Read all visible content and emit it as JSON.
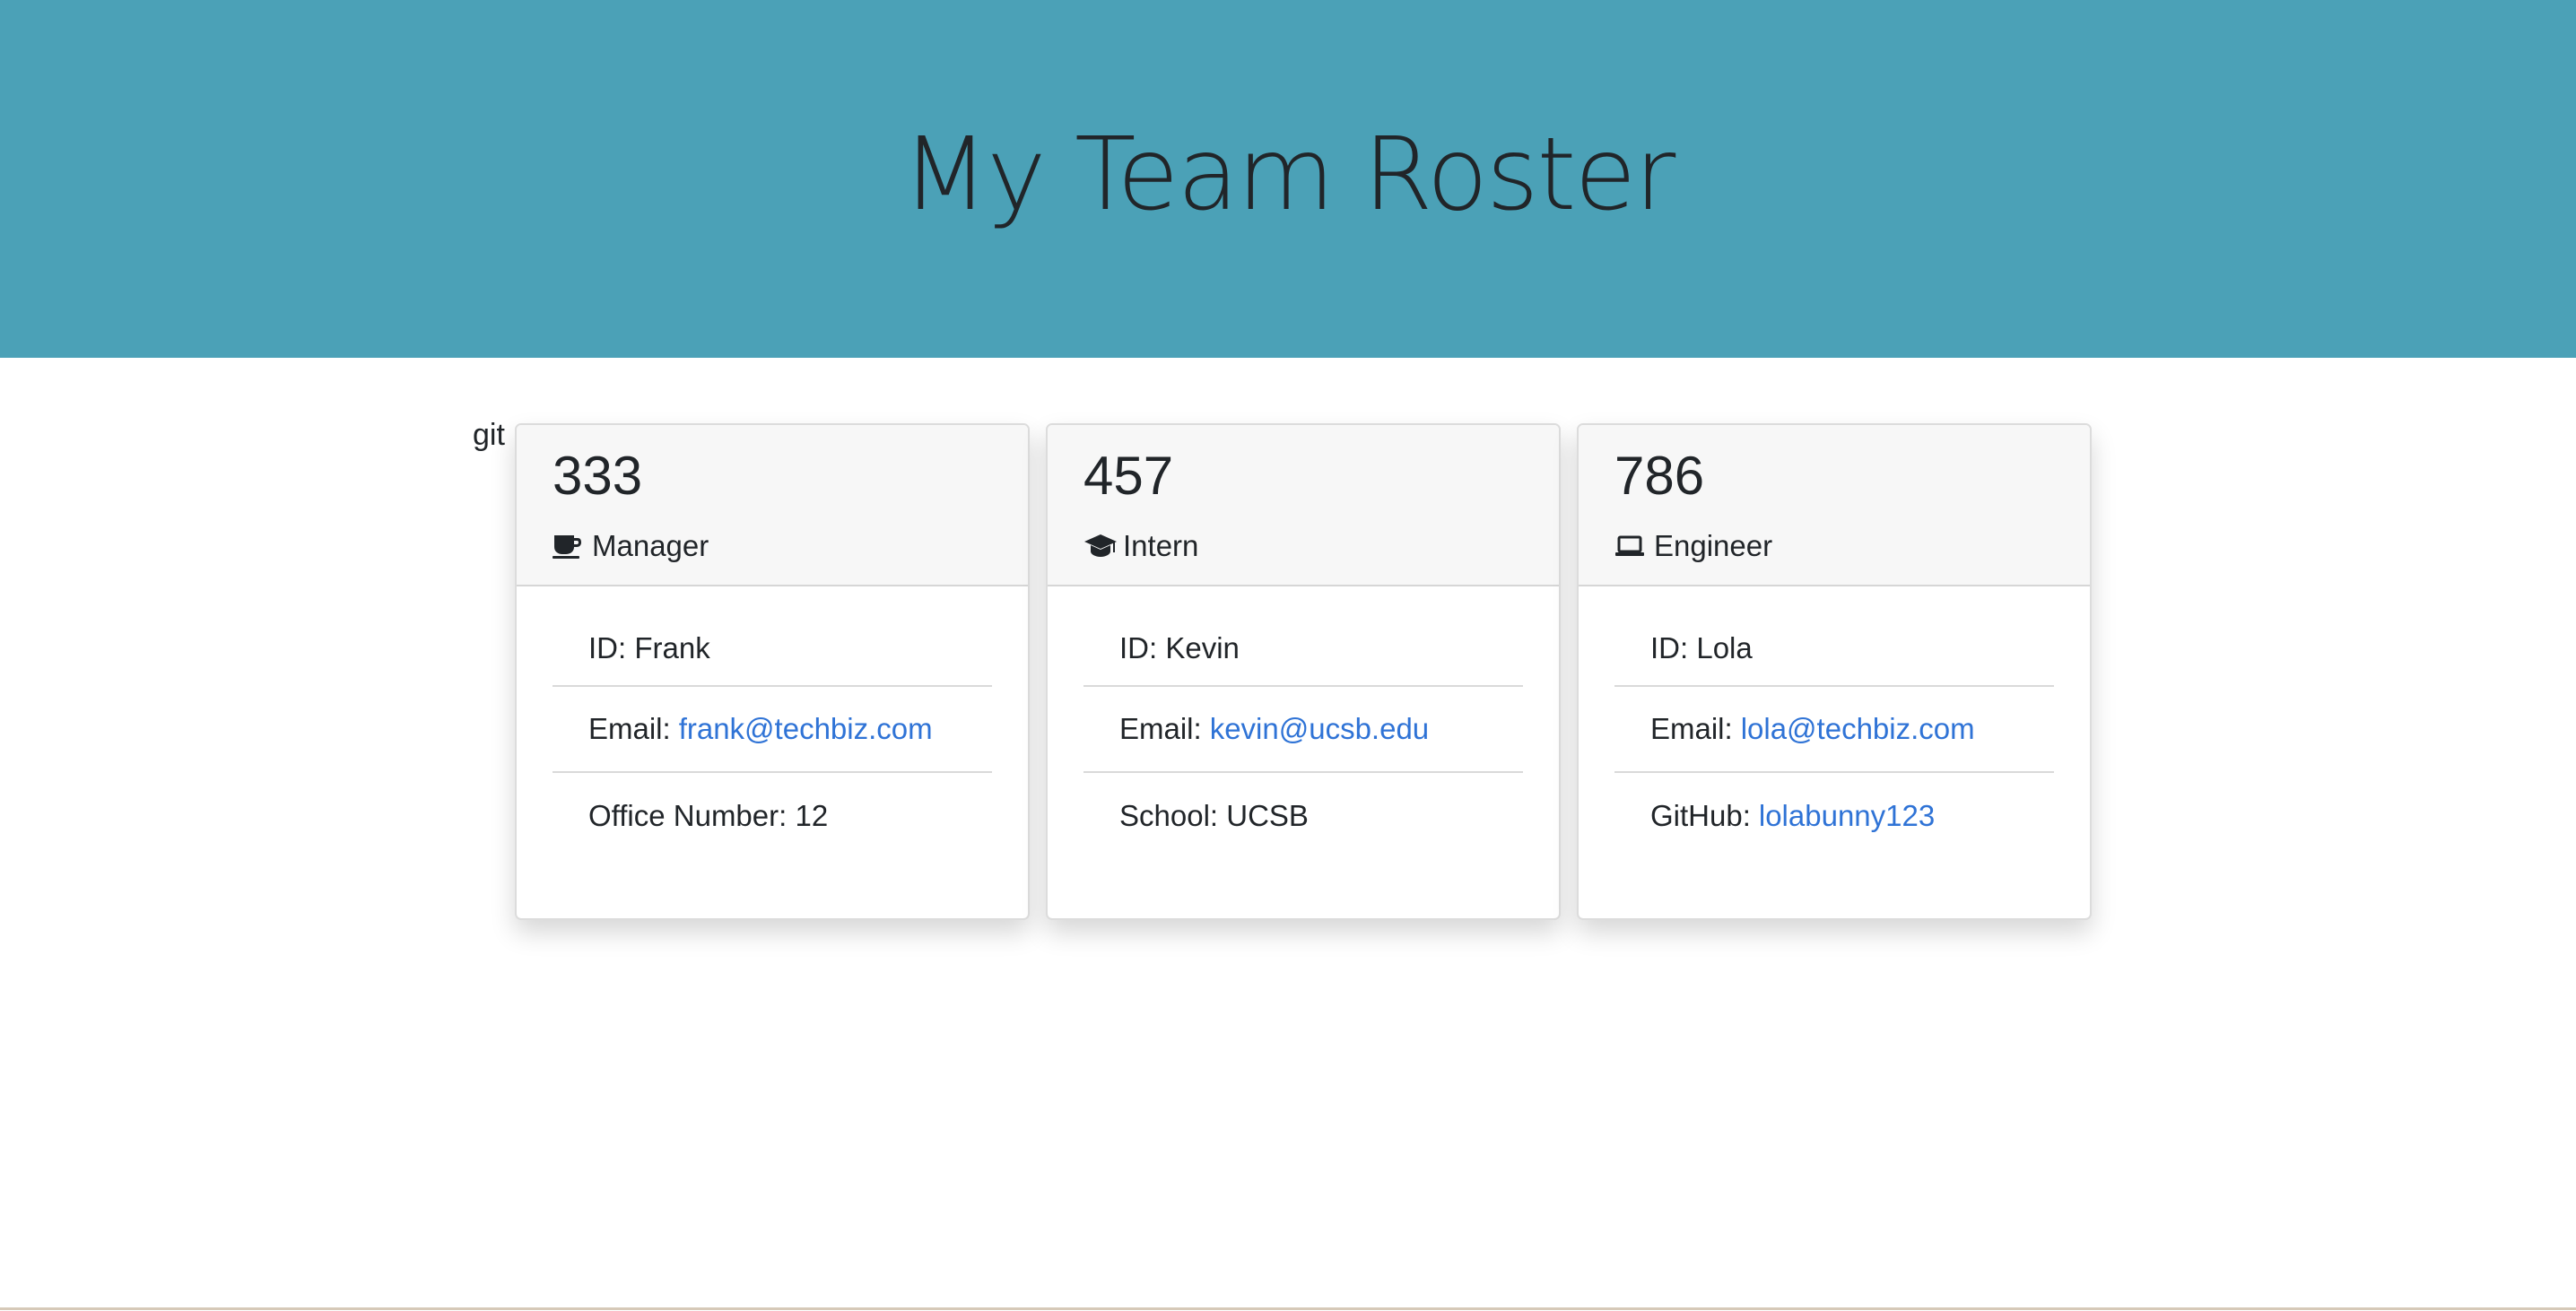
{
  "header": {
    "title": "My Team Roster"
  },
  "stray_text": "git",
  "cards": [
    {
      "id_number": "333",
      "role": "Manager",
      "role_icon": "coffee-icon",
      "id_label": "ID: Frank",
      "email_label": "Email:",
      "email": "frank@techbiz.com",
      "extra_label": "Office Number: 12"
    },
    {
      "id_number": "457",
      "role": "Intern",
      "role_icon": "graduation-cap-icon",
      "id_label": "ID: Kevin",
      "email_label": "Email:",
      "email": "kevin@ucsb.edu",
      "extra_label": "School: UCSB"
    },
    {
      "id_number": "786",
      "role": "Engineer",
      "role_icon": "laptop-icon",
      "id_label": "ID: Lola",
      "email_label": "Email:",
      "email": "lola@techbiz.com",
      "extra_label": "GitHub:",
      "extra_link": "lolabunny123"
    }
  ],
  "colors": {
    "hero_bg": "#4ba1b7",
    "link": "#2f73d6",
    "card_header_bg": "#f7f7f7"
  }
}
